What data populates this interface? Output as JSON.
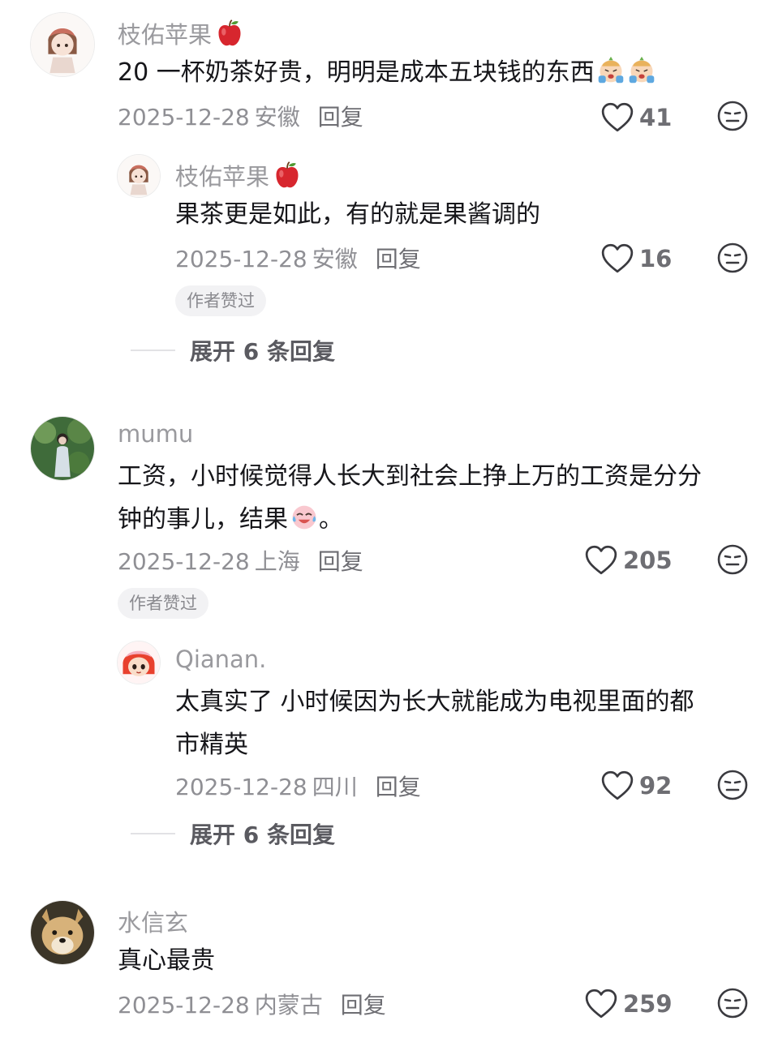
{
  "comments": [
    {
      "user": "枝佑苹果",
      "text_lines": [
        "20 一杯奶茶好贵，明明是成本五块钱的东西"
      ],
      "date": "2025-12-28",
      "location": "安徽",
      "reply_label": "回复",
      "likes": "41",
      "reply": {
        "user": "枝佑苹果",
        "text_lines": [
          "果茶更是如此，有的就是果酱调的"
        ],
        "date": "2025-12-28",
        "location": "安徽",
        "reply_label": "回复",
        "likes": "16",
        "badge": "作者赞过"
      },
      "expand": "展开 6 条回复"
    },
    {
      "user": "mumu",
      "text_lines": [
        "工资，小时候觉得人长大到社会上挣上万的工资是分分",
        "钟的事儿，结果"
      ],
      "text_tail": "。",
      "date": "2025-12-28",
      "location": "上海",
      "reply_label": "回复",
      "likes": "205",
      "badge": "作者赞过",
      "reply": {
        "user": "Qianan.",
        "text_lines": [
          "太真实了 小时候因为长大就能成为电视里面的都",
          "市精英"
        ],
        "date": "2025-12-28",
        "location": "四川",
        "reply_label": "回复",
        "likes": "92"
      },
      "expand": "展开 6 条回复"
    },
    {
      "user": "水信玄",
      "text_lines": [
        "真心最贵"
      ],
      "date": "2025-12-28",
      "location": "内蒙古",
      "reply_label": "回复",
      "likes": "259"
    }
  ],
  "icons": [
    "heart-icon",
    "neutral-face-icon",
    "apple-emoji",
    "crying-emoji",
    "laugh-cry-emoji"
  ],
  "colors": {
    "username": "#9a9a9e",
    "meta": "#8f8f94",
    "badge_bg": "#f2f2f4"
  }
}
